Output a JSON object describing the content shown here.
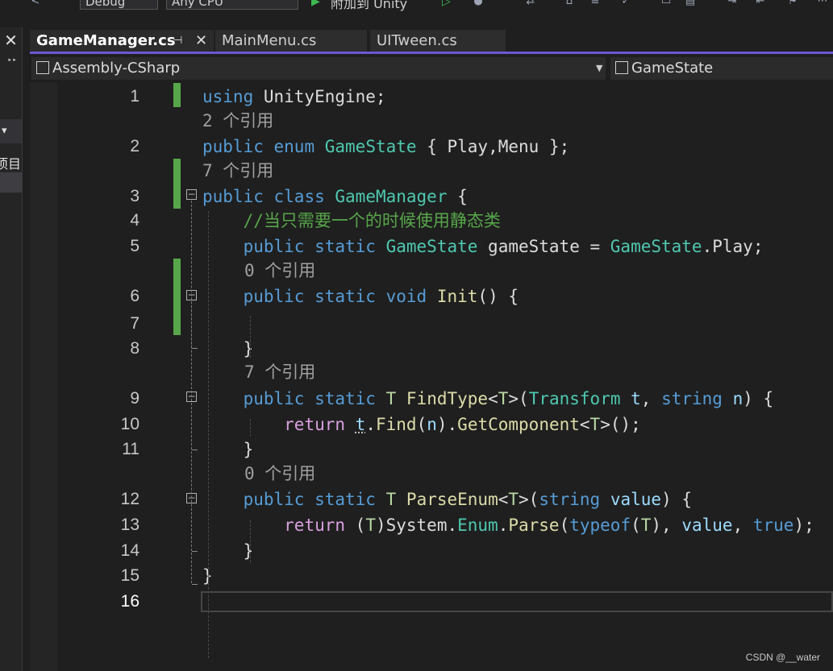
{
  "toolbar": {
    "config": "Debug",
    "platform": "Any CPU",
    "attach": "附加到 Unity"
  },
  "left_panel": {
    "close": "✕",
    "overflow": "‣‣",
    "dropdown": "▾",
    "item": "项目"
  },
  "tabs": [
    {
      "label": "GameManager.cs",
      "active": true
    },
    {
      "label": "MainMenu.cs",
      "active": false
    },
    {
      "label": "UITween.cs",
      "active": false
    }
  ],
  "tab_pin": "⊣",
  "tab_close": "✕",
  "nav": {
    "project": "Assembly-CSharp",
    "member": "GameState"
  },
  "code": {
    "lines": [
      {
        "num": "1",
        "lens": "",
        "tokens": [
          [
            "kw",
            "using"
          ],
          [
            "pn",
            " UnityEngine;"
          ]
        ]
      },
      {
        "num": "2",
        "lens": "2 个引用",
        "tokens": [
          [
            "kw",
            "public"
          ],
          [
            "pn",
            " "
          ],
          [
            "kw",
            "enum"
          ],
          [
            "pn",
            " "
          ],
          [
            "ty",
            "GameState"
          ],
          [
            "pn",
            " { "
          ],
          [
            "nm",
            "Play"
          ],
          [
            "pn",
            ","
          ],
          [
            "nm",
            "Menu"
          ],
          [
            "pn",
            " };"
          ]
        ]
      },
      {
        "num": "3",
        "lens": "7 个引用",
        "tokens": [
          [
            "kw",
            "public"
          ],
          [
            "pn",
            " "
          ],
          [
            "kw",
            "class"
          ],
          [
            "pn",
            " "
          ],
          [
            "ty",
            "GameManager"
          ],
          [
            "pn",
            " {"
          ]
        ]
      },
      {
        "num": "4",
        "lens": "",
        "tokens": [
          [
            "pn",
            "    "
          ],
          [
            "cm",
            "//当只需要一个的时候使用静态类"
          ]
        ]
      },
      {
        "num": "5",
        "lens": "",
        "tokens": [
          [
            "pn",
            "    "
          ],
          [
            "kw",
            "public"
          ],
          [
            "pn",
            " "
          ],
          [
            "kw",
            "static"
          ],
          [
            "pn",
            " "
          ],
          [
            "ty",
            "GameState"
          ],
          [
            "pn",
            " gameState = "
          ],
          [
            "ty",
            "GameState"
          ],
          [
            "pn",
            "."
          ],
          [
            "nm",
            "Play"
          ],
          [
            "pn",
            ";"
          ]
        ]
      },
      {
        "num": "6",
        "lens": "0 个引用",
        "tokens": [
          [
            "pn",
            "    "
          ],
          [
            "kw",
            "public"
          ],
          [
            "pn",
            " "
          ],
          [
            "kw",
            "static"
          ],
          [
            "pn",
            " "
          ],
          [
            "kw",
            "void"
          ],
          [
            "pn",
            " "
          ],
          [
            "fn",
            "Init"
          ],
          [
            "pn",
            "() {"
          ]
        ]
      },
      {
        "num": "7",
        "lens": "",
        "tokens": [
          [
            "pn",
            ""
          ]
        ]
      },
      {
        "num": "8",
        "lens": "",
        "tokens": [
          [
            "pn",
            "    }"
          ]
        ]
      },
      {
        "num": "9",
        "lens": "7 个引用",
        "tokens": [
          [
            "pn",
            "    "
          ],
          [
            "kw",
            "public"
          ],
          [
            "pn",
            " "
          ],
          [
            "kw",
            "static"
          ],
          [
            "pn",
            " "
          ],
          [
            "tp",
            "T"
          ],
          [
            "pn",
            " "
          ],
          [
            "fn",
            "FindType"
          ],
          [
            "pn",
            "<"
          ],
          [
            "tp",
            "T"
          ],
          [
            "pn",
            ">("
          ],
          [
            "ty",
            "Transform"
          ],
          [
            "pn",
            " "
          ],
          [
            "pr",
            "t"
          ],
          [
            "pn",
            ", "
          ],
          [
            "kw",
            "string"
          ],
          [
            "pn",
            " "
          ],
          [
            "pr",
            "n"
          ],
          [
            "pn",
            ") {"
          ]
        ]
      },
      {
        "num": "10",
        "lens": "",
        "tokens": [
          [
            "pn",
            "        "
          ],
          [
            "ctl",
            "return"
          ],
          [
            "pn",
            " "
          ],
          [
            "prsq",
            "t"
          ],
          [
            "pn",
            "."
          ],
          [
            "fn",
            "Find"
          ],
          [
            "pn",
            "("
          ],
          [
            "pr",
            "n"
          ],
          [
            "pn",
            ")."
          ],
          [
            "fn",
            "GetComponent"
          ],
          [
            "pn",
            "<"
          ],
          [
            "tp",
            "T"
          ],
          [
            "pn",
            ">();"
          ]
        ]
      },
      {
        "num": "11",
        "lens": "",
        "tokens": [
          [
            "pn",
            "    }"
          ]
        ]
      },
      {
        "num": "12",
        "lens": "0 个引用",
        "tokens": [
          [
            "pn",
            "    "
          ],
          [
            "kw",
            "public"
          ],
          [
            "pn",
            " "
          ],
          [
            "kw",
            "static"
          ],
          [
            "pn",
            " "
          ],
          [
            "tp",
            "T"
          ],
          [
            "pn",
            " "
          ],
          [
            "fn",
            "ParseEnum"
          ],
          [
            "pn",
            "<"
          ],
          [
            "tp",
            "T"
          ],
          [
            "pn",
            ">("
          ],
          [
            "kw",
            "string"
          ],
          [
            "pn",
            " "
          ],
          [
            "pr",
            "value"
          ],
          [
            "pn",
            ") {"
          ]
        ]
      },
      {
        "num": "13",
        "lens": "",
        "tokens": [
          [
            "pn",
            "        "
          ],
          [
            "ctl",
            "return"
          ],
          [
            "pn",
            " ("
          ],
          [
            "tp",
            "T"
          ],
          [
            "pn",
            ")System."
          ],
          [
            "ty",
            "Enum"
          ],
          [
            "pn",
            "."
          ],
          [
            "fn",
            "Parse"
          ],
          [
            "pn",
            "("
          ],
          [
            "kw",
            "typeof"
          ],
          [
            "pn",
            "("
          ],
          [
            "tp",
            "T"
          ],
          [
            "pn",
            "), "
          ],
          [
            "pr",
            "value"
          ],
          [
            "pn",
            ", "
          ],
          [
            "kw",
            "true"
          ],
          [
            "pn",
            ");"
          ]
        ]
      },
      {
        "num": "14",
        "lens": "",
        "tokens": [
          [
            "pn",
            "    }"
          ]
        ]
      },
      {
        "num": "15",
        "lens": "",
        "tokens": [
          [
            "pn",
            "}"
          ]
        ]
      },
      {
        "num": "16",
        "lens": "",
        "tokens": [
          [
            "pn",
            ""
          ]
        ]
      }
    ]
  },
  "watermark": "CSDN @__water"
}
